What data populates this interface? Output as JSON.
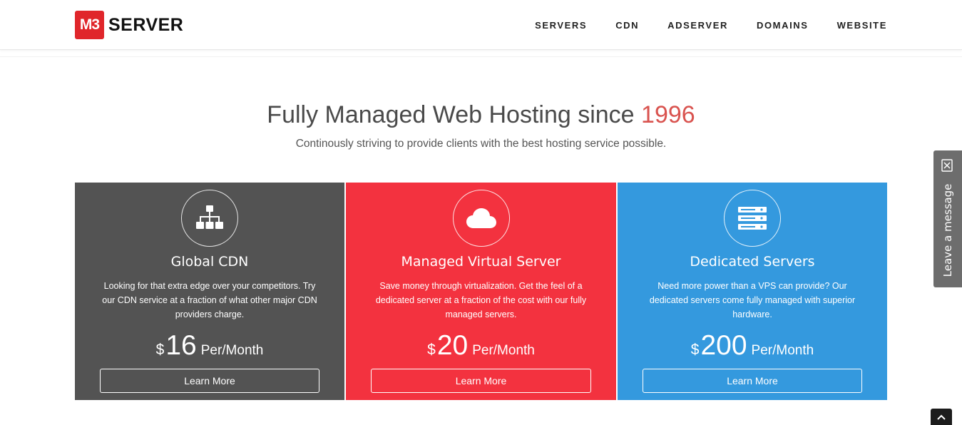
{
  "brand": {
    "logo_mark": "M3",
    "logo_text": "SERVER",
    "accent_color": "#e0262b"
  },
  "nav": {
    "items": [
      {
        "label": "SERVERS"
      },
      {
        "label": "CDN"
      },
      {
        "label": "ADSERVER"
      },
      {
        "label": "DOMAINS"
      },
      {
        "label": "WEBSITE"
      }
    ]
  },
  "hero": {
    "title_prefix": "Fully Managed Web Hosting since ",
    "title_year": "1996",
    "subtitle": "Continously striving to provide clients with the best hosting service possible."
  },
  "cards": [
    {
      "icon": "sitemap-icon",
      "title": "Global CDN",
      "description": "Looking for that extra edge over your competitors. Try our CDN service at a fraction of what other major CDN providers charge.",
      "currency": "$",
      "amount": "16",
      "period": "Per/Month",
      "button": "Learn More",
      "color": "#535353"
    },
    {
      "icon": "cloud-icon",
      "title": "Managed Virtual Server",
      "description": "Save money through virtualization. Get the feel of a dedicated server at a fraction of the cost with our fully managed servers.",
      "currency": "$",
      "amount": "20",
      "period": "Per/Month",
      "button": "Learn More",
      "color": "#f3323f"
    },
    {
      "icon": "server-stack-icon",
      "title": "Dedicated Servers",
      "description": "Need more power than a VPS can provide? Our dedicated servers come fully managed with superior hardware.",
      "currency": "$",
      "amount": "200",
      "period": "Per/Month",
      "button": "Learn More",
      "color": "#3499de"
    }
  ],
  "side_tab": {
    "label": "Leave a message",
    "icon": "close-icon"
  },
  "scroll_top": {
    "icon": "chevron-up-icon"
  }
}
